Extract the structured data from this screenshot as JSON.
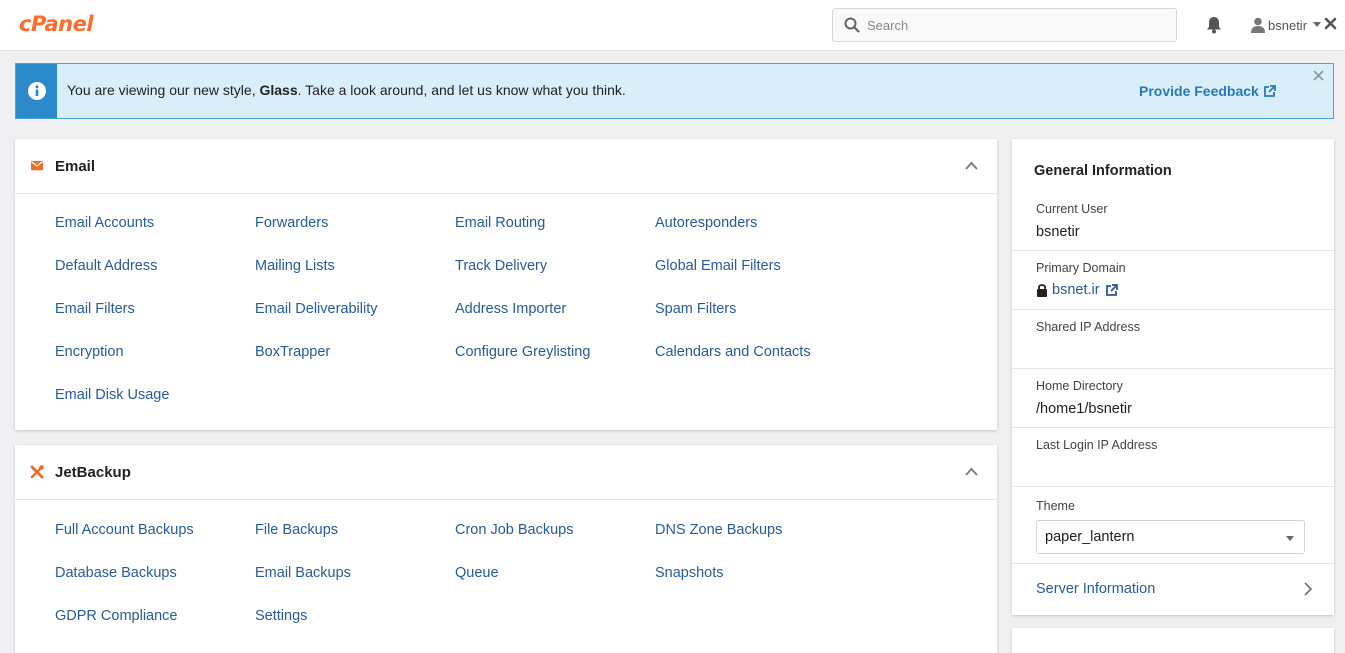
{
  "header": {
    "logo": "cPanel",
    "search_placeholder": "Search",
    "username": "bsnetir"
  },
  "notice": {
    "text_before": "You are viewing our new style, ",
    "style_name": "Glass",
    "text_after": ". Take a look around, and let us know what you think.",
    "feedback_label": "Provide Feedback"
  },
  "email": {
    "title": "Email",
    "links": [
      "Email Accounts",
      "Forwarders",
      "Email Routing",
      "Autoresponders",
      "Default Address",
      "Mailing Lists",
      "Track Delivery",
      "Global Email Filters",
      "Email Filters",
      "Email Deliverability",
      "Address Importer",
      "Spam Filters",
      "Encryption",
      "BoxTrapper",
      "Configure Greylisting",
      "Calendars and Contacts",
      "Email Disk Usage"
    ]
  },
  "jetbackup": {
    "title": "JetBackup",
    "links": [
      "Full Account Backups",
      "File Backups",
      "Cron Job Backups",
      "DNS Zone Backups",
      "Database Backups",
      "Email Backups",
      "Queue",
      "Snapshots",
      "GDPR Compliance",
      "Settings"
    ]
  },
  "general_info": {
    "title": "General Information",
    "current_user_label": "Current User",
    "current_user": "bsnetir",
    "primary_domain_label": "Primary Domain",
    "primary_domain": "bsnet.ir",
    "shared_ip_label": "Shared IP Address",
    "home_dir_label": "Home Directory",
    "home_dir": "/home1/bsnetir",
    "last_login_label": "Last Login IP Address",
    "theme_label": "Theme",
    "theme_value": "paper_lantern",
    "server_info_label": "Server Information"
  },
  "colors": {
    "brand": "#ff6c2c",
    "link": "#275c9a",
    "notice_bg": "#d8eef8",
    "notice_accent": "#2a8ac9"
  }
}
